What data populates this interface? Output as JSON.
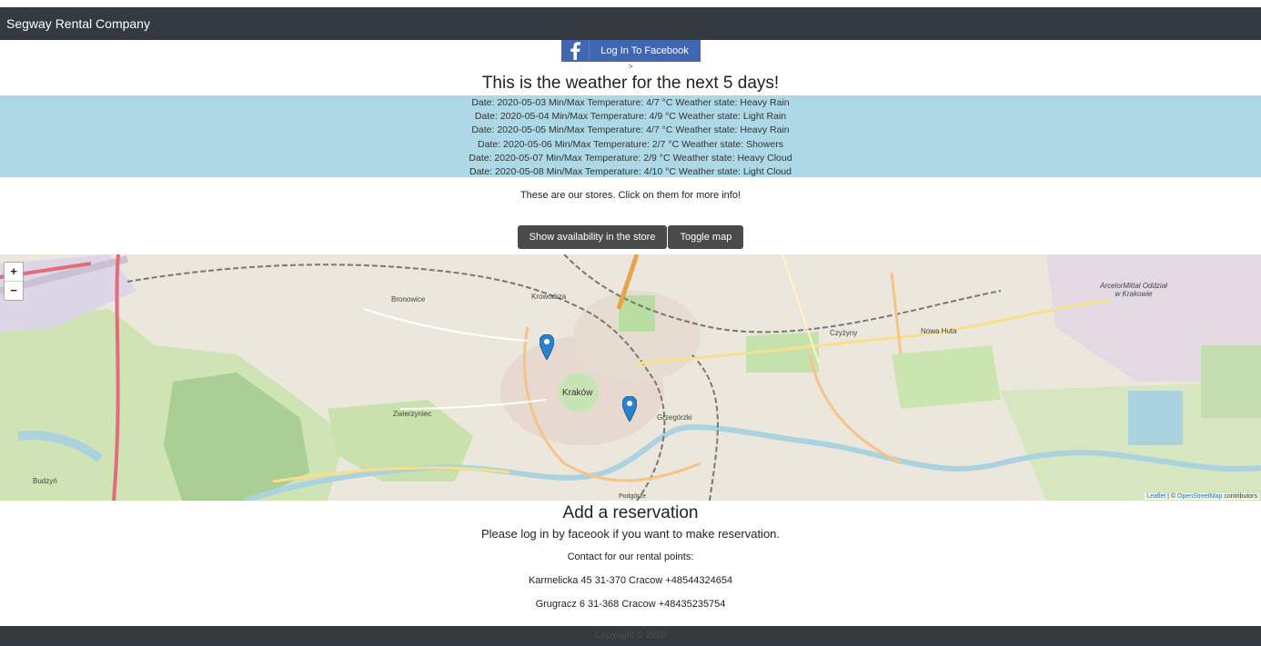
{
  "nav": {
    "brand": "Segway Rental Company"
  },
  "facebook": {
    "button_label": "Log In To Facebook"
  },
  "stray_text": ">",
  "weather": {
    "title": "This is the weather for the next 5 days!",
    "rows": [
      "Date: 2020-05-03 Min/Max Temperature: 4/7 °C Weather state: Heavy Rain",
      "Date: 2020-05-04 Min/Max Temperature: 4/9 °C Weather state: Light Rain",
      "Date: 2020-05-05 Min/Max Temperature: 4/7 °C Weather state: Heavy Rain",
      "Date: 2020-05-06 Min/Max Temperature: 2/7 °C Weather state: Showers",
      "Date: 2020-05-07 Min/Max Temperature: 2/9 °C Weather state: Heavy Cloud",
      "Date: 2020-05-08 Min/Max Temperature: 4/10 °C Weather state: Light Cloud"
    ]
  },
  "stores": {
    "intro": "These are our stores. Click on them for more info!",
    "show_availability_label": "Show availability in the store",
    "toggle_map_label": "Toggle map"
  },
  "map": {
    "zoom_in": "+",
    "zoom_out": "−",
    "attribution_leaflet": "Leaflet",
    "attribution_sep": " | © ",
    "attribution_osm": "OpenStreetMap",
    "attribution_tail": " contributors",
    "labels": {
      "krakow": "Kraków",
      "bronowice": "Bronowice",
      "krowodrza": "Krowodrza",
      "zwierzyniec": "Zwierzyniec",
      "grzegorzki": "Grzegórzki",
      "czyzyny": "Czyżyny",
      "nowa_huta": "Nowa Huta",
      "podgorze": "Podgórze",
      "budzyn": "Budzyń",
      "arcelor": "ArcelorMittal Oddział w Krakowie"
    },
    "marker_icon": "map-marker-icon",
    "colors": {
      "water": "#aad3df",
      "park": "#c8e6a8",
      "forest": "#add19e",
      "road_major": "#f7c38a",
      "rail": "#777777"
    }
  },
  "reservation": {
    "title": "Add a reservation",
    "login_prompt": "Please log in by faceook if you want to make reservation.",
    "contact_heading": "Contact for our rental points:",
    "points": [
      "Karmelicka 45 31-370 Cracow +48544324654",
      "Grugracz 6 31-368 Cracow +48435235754"
    ]
  },
  "footer": {
    "copyright": "Copyright © 2020"
  },
  "colors": {
    "navbar": "#343a40",
    "facebook": "#4267b2",
    "forecast_bg": "#add8e6",
    "button_dark": "#4a4a4a"
  }
}
